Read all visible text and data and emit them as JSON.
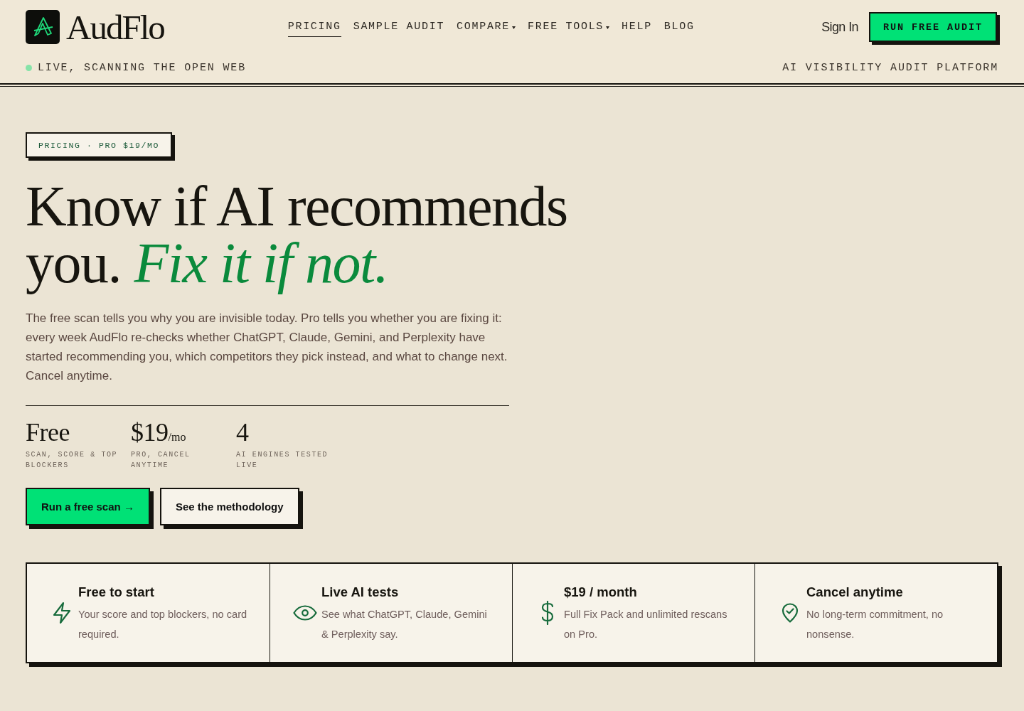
{
  "header": {
    "brand": "AudFlo",
    "nav": [
      {
        "label": "PRICING",
        "selected": true,
        "dropdown": false
      },
      {
        "label": "SAMPLE AUDIT",
        "selected": false,
        "dropdown": false
      },
      {
        "label": "COMPARE",
        "selected": false,
        "dropdown": true
      },
      {
        "label": "FREE TOOLS",
        "selected": false,
        "dropdown": true
      },
      {
        "label": "HELP",
        "selected": false,
        "dropdown": false
      },
      {
        "label": "BLOG",
        "selected": false,
        "dropdown": false
      }
    ],
    "sign_in": "Sign In",
    "cta": "RUN FREE AUDIT",
    "status": "LIVE, SCANNING THE OPEN WEB",
    "tagline": "AI VISIBILITY AUDIT PLATFORM"
  },
  "hero": {
    "badge": "PRICING · PRO $19/MO",
    "headline": "Know if AI recommends you. *Fix it if not.*",
    "intro": "The free scan tells you why you are invisible today. Pro tells you whether you are fixing it: every week AudFlo re-checks whether ChatGPT, Claude, Gemini, and Perplexity have started recommending you, which competitors they pick instead, and what to change next. Cancel anytime.",
    "stats": [
      {
        "value": "Free",
        "caption": "SCAN, SCORE & TOP BLOCKERS"
      },
      {
        "value": "$19",
        "unit": "/mo",
        "caption": "PRO, CANCEL ANYTIME"
      },
      {
        "value": "4",
        "caption": "AI ENGINES TESTED LIVE"
      }
    ],
    "buttons": [
      {
        "label": "Run a free scan →",
        "kind": "primary"
      },
      {
        "label": "See the methodology",
        "kind": "secondary"
      }
    ]
  },
  "features": [
    {
      "title": "Free to start",
      "text": "Your score and top blockers, no card required."
    },
    {
      "title": "Live AI tests",
      "text": "See what ChatGPT, Claude, Gemini & Perplexity say."
    },
    {
      "title": "$19 / month",
      "text": "Full Fix Pack and unlimited rescans on Pro."
    },
    {
      "title": "Cancel anytime",
      "text": "No long-term commitment, no nonsense."
    }
  ]
}
